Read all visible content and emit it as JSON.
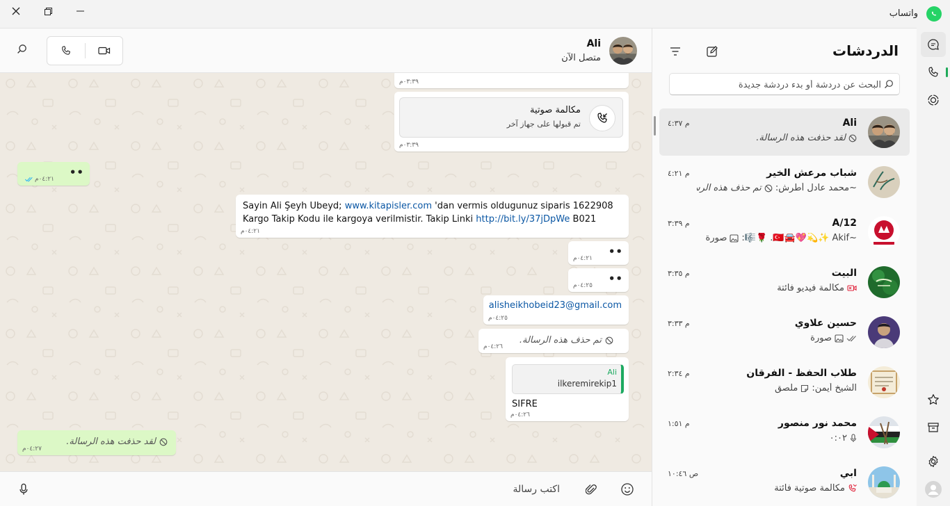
{
  "window": {
    "title": "واتساب"
  },
  "nav": {
    "items": [
      "chats-icon",
      "calls-icon",
      "status-icon",
      "starred-icon",
      "archived-icon",
      "settings-icon",
      "profile-icon"
    ],
    "accent": "#1faa59"
  },
  "chat_list": {
    "title": "الدردشات",
    "search_placeholder": "البحث عن دردشة أو بدء دردشة جديدة",
    "items": [
      {
        "name": "Ali",
        "time": "م ٤:٣٧",
        "preview": "لقد حذفت هذه الرسالة.",
        "icon": "blocked-icon"
      },
      {
        "name": "شباب مرعش الخير",
        "time": "م ٤:٢١",
        "preview_sender": "~محمد عادل أطرش:",
        "preview": "تم حذف هذه الرس...",
        "icon": "blocked-icon"
      },
      {
        "name": "12/A",
        "time": "م ٣:٣٩",
        "preview_sender": "~🇹🇷🚘💖💫✨ Akif. 🌹🎼:",
        "preview": "صورة",
        "icon": "image-icon"
      },
      {
        "name": "البيت",
        "time": "م ٣:٣٥",
        "preview": "مكالمة فيديو فائتة",
        "icon": "missed-video-icon"
      },
      {
        "name": "حسين علاوي",
        "time": "م ٣:٣٣",
        "preview": "صورة",
        "icon": "image-icon"
      },
      {
        "name": "طلاب الحفظ - الفرقان",
        "time": "م ٢:٣٤",
        "preview_sender": "الشيخ أيمن:",
        "preview": "ملصق",
        "icon": "sticker-icon"
      },
      {
        "name": "محمد نور منصور",
        "time": "م ١:٥١",
        "preview": "٠:٠٢",
        "icon": "mic-icon"
      },
      {
        "name": "ابي",
        "time": "ص ١٠:٤٦",
        "preview": "مكالمة صوتية فائتة",
        "icon": "missed-call-icon"
      }
    ]
  },
  "chat": {
    "name": "Ali",
    "status": "متصل الآن",
    "composer_placeholder": "اكتب رسالة",
    "messages": {
      "m0_time": "٠٣:٣٩م",
      "call_title": "مكالمة صوتية",
      "call_sub": "تم قبولها على جهاز آخر",
      "call_time": "٠٣:٣٩م",
      "out1_text": "••",
      "out1_time": "٠٤:٢١م",
      "kargo_pre": "Sayin Ali Şeyh Ubeyd; ",
      "kargo_link1": "www.kitapisler.com",
      "kargo_mid": " 'dan vermis oldugunuz siparis 1622908 Kargo Takip Kodu ile kargoya verilmistir. Takip Linki ",
      "kargo_link2": "http://bit.ly/37jDpWe",
      "kargo_post": " B021",
      "kargo_time": "٠٤:٢١م",
      "dots2_text": "••",
      "dots2_time": "٠٤:٢١م",
      "dots3_text": "••",
      "dots3_time": "٠٤:٢٥م",
      "email": "alisheikhobeid23@gmail.com",
      "email_time": "٠٤:٢٥م",
      "deleted_in": "تم حذف هذه الرسالة.",
      "deleted_in_time": "٠٤:٢٦م",
      "quote_name": "Ali",
      "quote_text": "ilkeremirekip1",
      "reply_text": "SIFRE",
      "reply_time": "٠٤:٢٦م",
      "deleted_out": "لقد حذفت هذه الرسالة.",
      "deleted_out_time": "٠٤:٢٧م"
    }
  }
}
